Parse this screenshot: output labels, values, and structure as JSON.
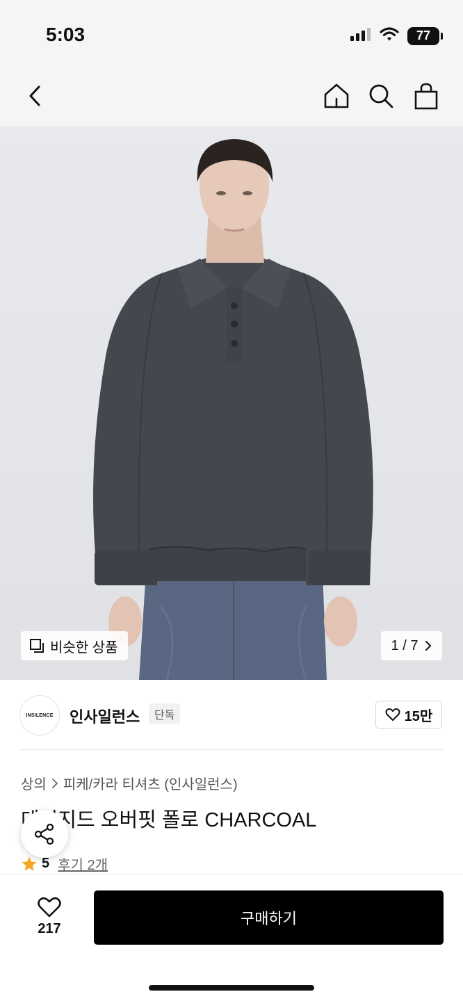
{
  "status": {
    "time": "5:03",
    "battery": "77",
    "icons": [
      "signal-icon",
      "wifi-icon",
      "battery-icon"
    ]
  },
  "nav": {
    "icons": [
      "back-chevron-icon",
      "home-icon",
      "search-icon",
      "shopping-bag-icon"
    ]
  },
  "gallery": {
    "similar_label": "비슷한 상품",
    "pager": "1 / 7",
    "colors": {
      "background": "#e5e7ea",
      "garment": "#45474f",
      "denim": "#5a6782"
    }
  },
  "brand": {
    "logo_text": "INSILENCE",
    "name": "인사일런스",
    "badge": "단독",
    "likes": "15만"
  },
  "product": {
    "breadcrumb": [
      "상의",
      "피케/카라 티셔츠 (인사일런스)"
    ],
    "title": "데미지드 오버핏 폴로 CHARCOAL",
    "rating": "5",
    "reviews": "후기 2개"
  },
  "bottom": {
    "wish_count": "217",
    "buy_label": "구매하기"
  },
  "colors": {
    "accent": "#f5a623",
    "primary_button": "#000000"
  }
}
